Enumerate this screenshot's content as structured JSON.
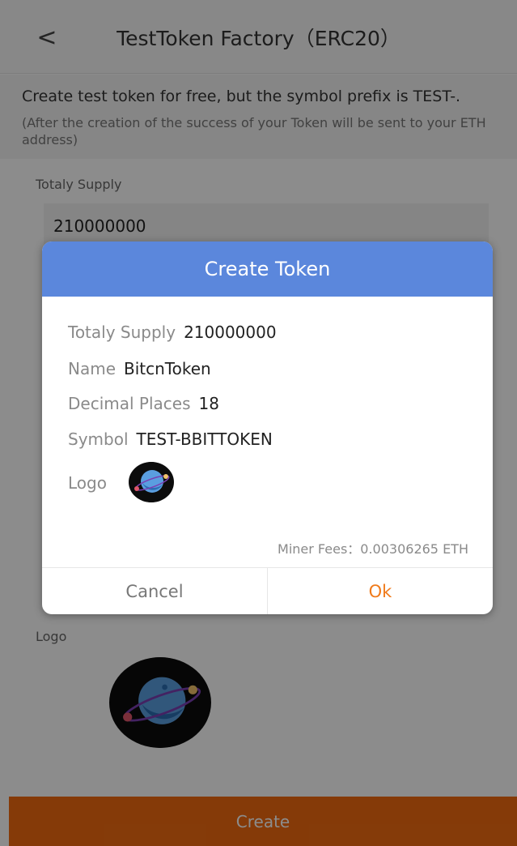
{
  "header": {
    "back_icon": "chevron-left-icon",
    "back_glyph": "<",
    "title": "TestToken Factory（ERC20）"
  },
  "intro": {
    "main": "Create test token for free, but the symbol prefix is TEST-.",
    "note": "(After the creation of the success of your Token will be sent to your ETH address)"
  },
  "form": {
    "supply_label": "Totaly Supply",
    "supply_value": "210000000",
    "logo_label": "Logo",
    "logo_icon": "planet-logo-icon"
  },
  "create_button": "Create",
  "colors": {
    "accent": "#f26b10",
    "dialog_header": "#5b87dc",
    "ok": "#f07a1a"
  },
  "dialog": {
    "title": "Create Token",
    "rows": [
      {
        "key": "Totaly Supply",
        "value": "210000000"
      },
      {
        "key": "Name",
        "value": "BitcnToken"
      },
      {
        "key": "Decimal Places",
        "value": "18"
      },
      {
        "key": "Symbol",
        "value": "TEST-BBITTOKEN"
      }
    ],
    "logo_label": "Logo",
    "fees": "Miner Fees：0.00306265 ETH",
    "cancel": "Cancel",
    "ok": "Ok"
  }
}
